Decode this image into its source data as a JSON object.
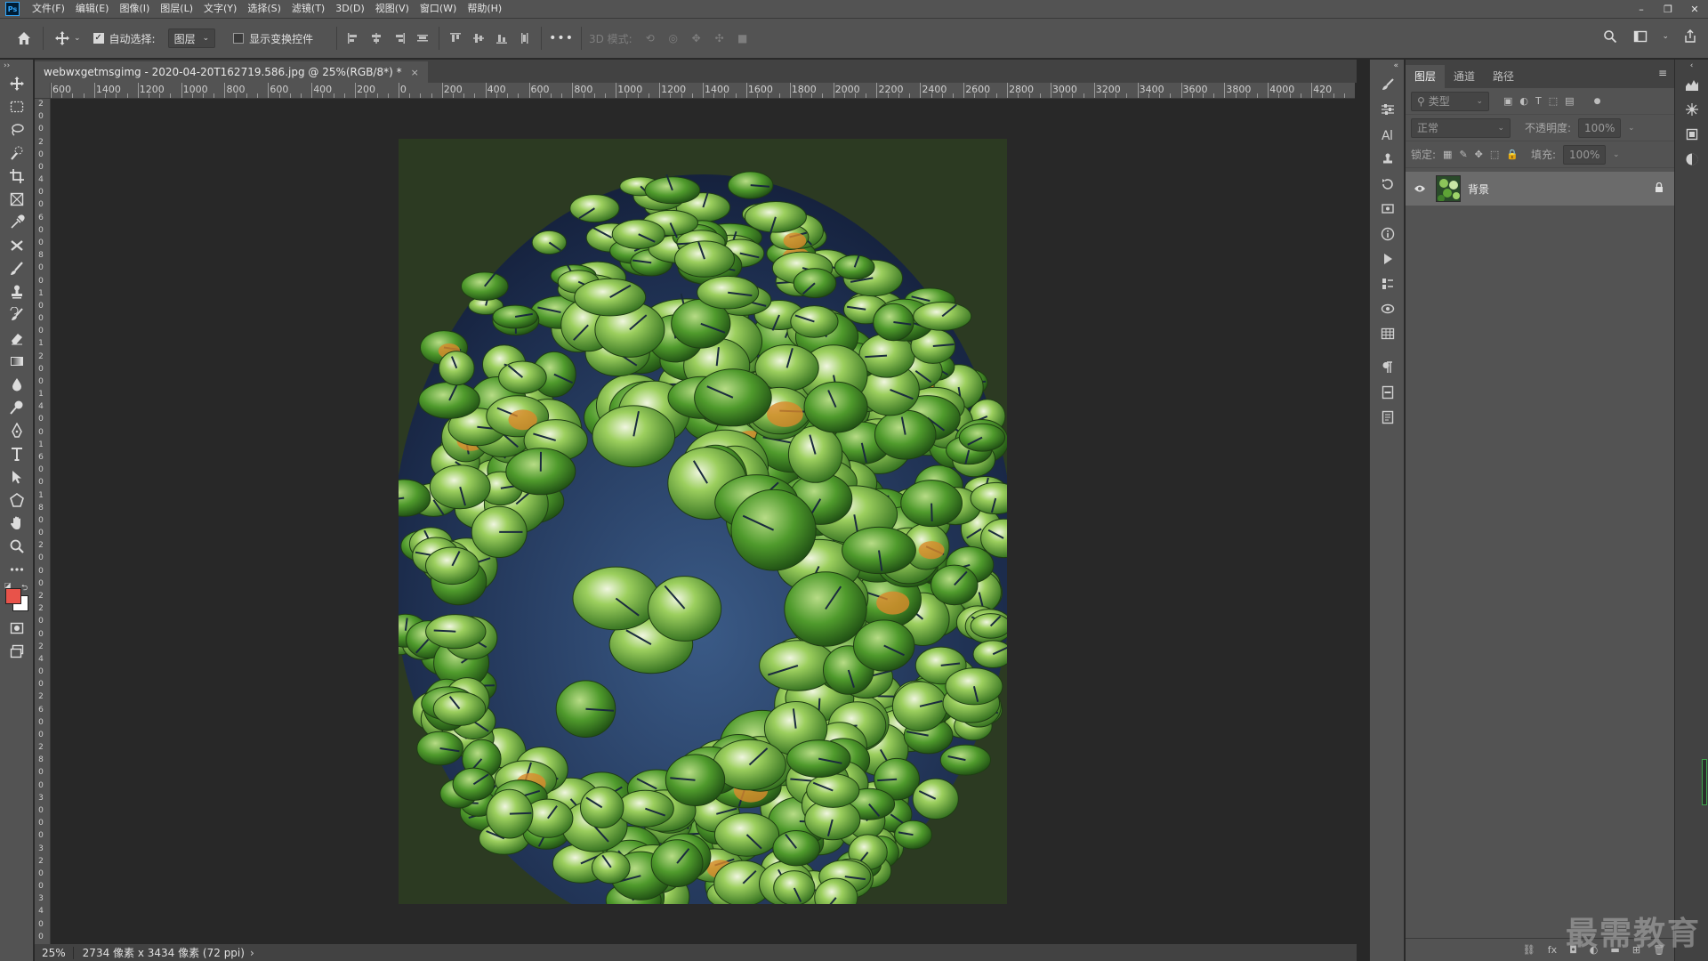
{
  "app": {
    "logo": "Ps"
  },
  "menu": [
    "文件(F)",
    "编辑(E)",
    "图像(I)",
    "图层(L)",
    "文字(Y)",
    "选择(S)",
    "滤镜(T)",
    "3D(D)",
    "视图(V)",
    "窗口(W)",
    "帮助(H)"
  ],
  "window_controls": {
    "minimize": "–",
    "restore": "❐",
    "close": "✕"
  },
  "options": {
    "auto_select_label": "自动选择:",
    "auto_select_checked": true,
    "auto_select_target": "图层",
    "show_transform_label": "显示变换控件",
    "show_transform_checked": false,
    "more": "•••",
    "mode_3d_label": "3D 模式:"
  },
  "document": {
    "tab_title": "webwxgetmsgimg - 2020-04-20T162719.586.jpg @ 25%(RGB/8*) *",
    "close": "×"
  },
  "ruler": {
    "top_labels": [
      "600",
      "1400",
      "1200",
      "1000",
      "800",
      "600",
      "400",
      "200",
      "0",
      "200",
      "400",
      "600",
      "800",
      "1000",
      "1200",
      "1400",
      "1600",
      "1800",
      "2000",
      "2200",
      "2400",
      "2600",
      "2800",
      "3000",
      "3200",
      "3400",
      "3600",
      "3800",
      "4000",
      "420"
    ],
    "left_labels": [
      "2",
      "0",
      "0",
      "2",
      "0",
      "0",
      "4",
      "0",
      "0",
      "6",
      "0",
      "0",
      "8",
      "0",
      "0",
      "1",
      "0",
      "0",
      "0",
      "1",
      "2",
      "0",
      "0",
      "1",
      "4",
      "0",
      "0",
      "1",
      "6",
      "0",
      "0",
      "1",
      "8",
      "0",
      "0",
      "2",
      "0",
      "0",
      "0",
      "2",
      "2",
      "0",
      "0",
      "2",
      "4",
      "0",
      "0",
      "2",
      "6",
      "0",
      "0",
      "2",
      "8",
      "0",
      "0",
      "3",
      "0",
      "0",
      "0",
      "3",
      "2",
      "0",
      "0",
      "3",
      "4",
      "0",
      "0"
    ]
  },
  "status": {
    "zoom": "25%",
    "info": "2734 像素 x 3434 像素 (72 ppi)",
    "arrow": "›"
  },
  "layers_panel": {
    "tabs": [
      "图层",
      "通道",
      "路径"
    ],
    "active_tab": 0,
    "menu_icon": "≡",
    "filter_placeholder": "类型",
    "blend_mode": "正常",
    "opacity_label": "不透明度:",
    "opacity_value": "100%",
    "lock_label": "锁定:",
    "fill_label": "填充:",
    "fill_value": "100%",
    "layers": [
      {
        "name": "背景",
        "visible": true,
        "locked": true
      }
    ],
    "bottom_icons": [
      "link-icon",
      "fx-icon",
      "mask-icon",
      "adjustment-icon",
      "folder-icon",
      "new-layer-icon",
      "trash-icon"
    ],
    "bottom_labels": [
      "⛓",
      "fx",
      "◘",
      "◐",
      "▬",
      "⊞",
      "🗑"
    ]
  },
  "watermark": "最需教育",
  "colors": {
    "foreground": "#e8534a",
    "background": "#ffffff",
    "ui_dark": "#535353",
    "canvas_bg": "#282828"
  }
}
